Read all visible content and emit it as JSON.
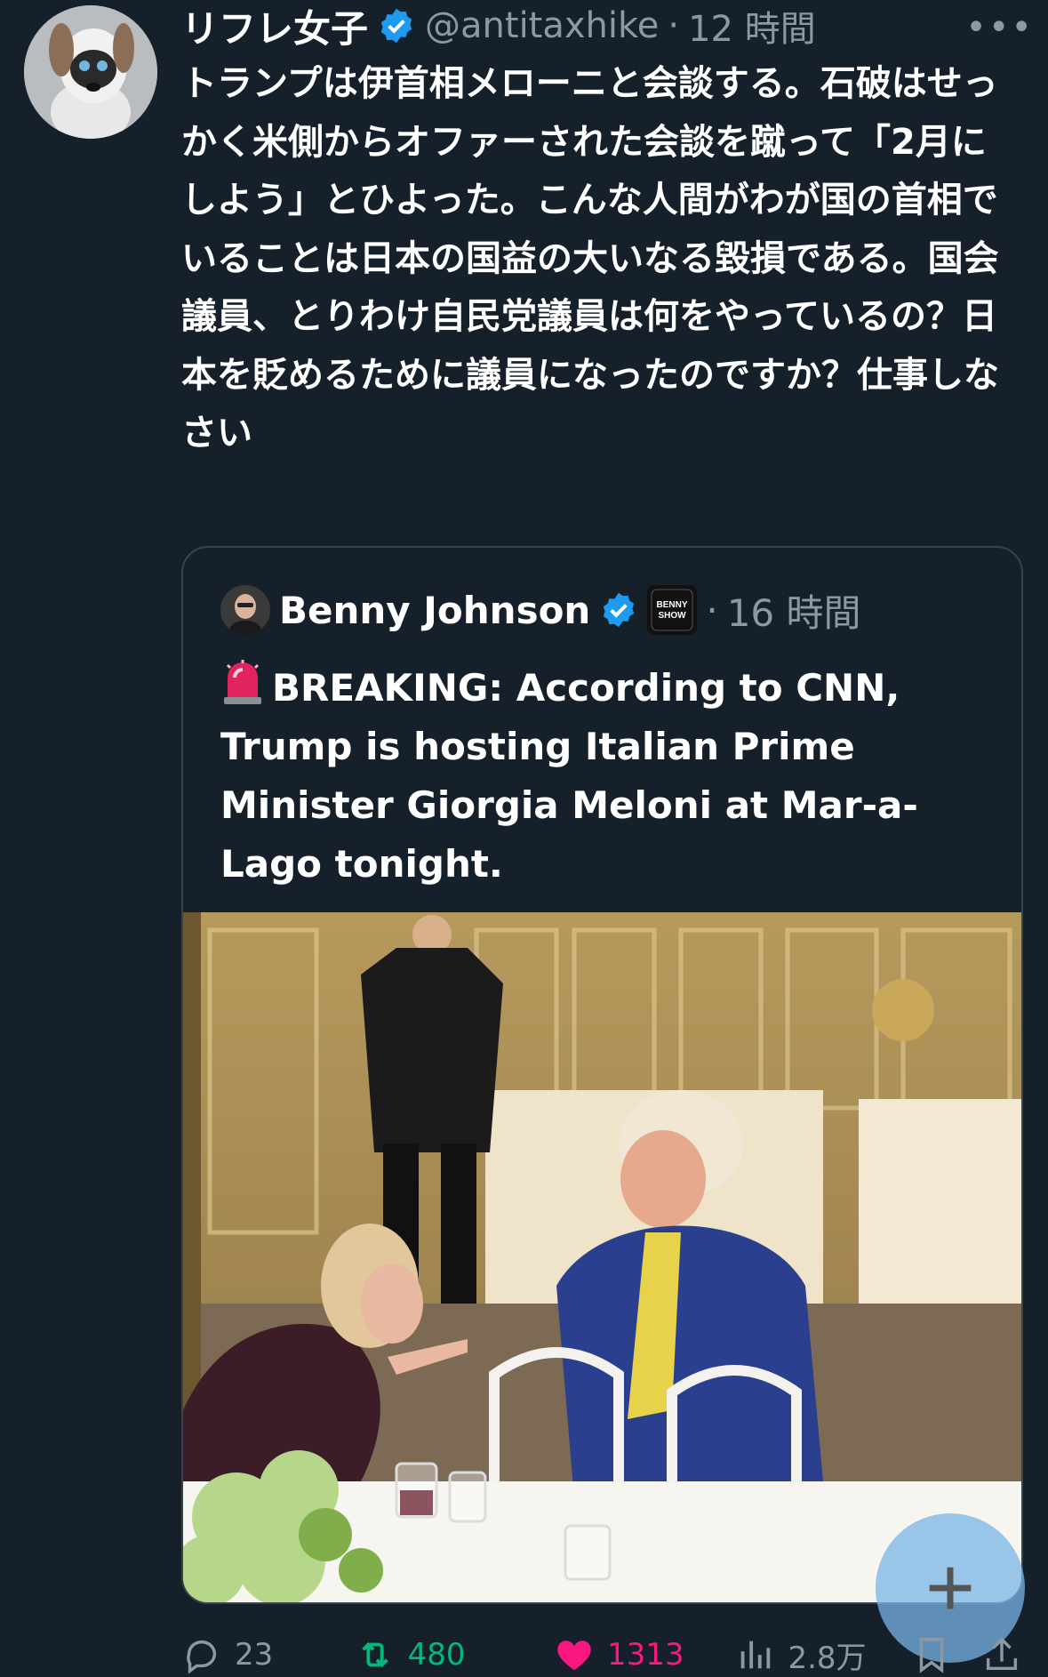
{
  "tweet": {
    "display_name": "リフレ女子",
    "handle": "@antitaxhike",
    "separator": "·",
    "time": "12 時間",
    "more_label": "•••",
    "body": "トランプは伊首相メローニと会談する。石破はせっかく米側からオファーされた会談を蹴って「2月にしよう」とひよった。こんな人間がわが国の首相でいることは日本の国益の大いなる毀損である。国会議員、とりわけ自民党議員は何をやっているの？日本を貶めるために議員になったのですか？仕事しなさい"
  },
  "quote": {
    "display_name": "Benny Johnson",
    "badge_text": "BENNY SHOW",
    "separator": "·",
    "time": "16 時間",
    "body": "BREAKING: According to CNN, Trump is hosting Italian Prime Minister Giorgia Meloni at Mar-a-Lago tonight."
  },
  "actions": {
    "replies": "23",
    "retweets": "480",
    "likes": "1313",
    "views": "2.8万"
  },
  "colors": {
    "background": "#15202b",
    "muted": "#8b98a5",
    "retweet": "#00ba7c",
    "like": "#f91880",
    "verified": "#1d9bf0"
  },
  "icons": [
    "verified-icon",
    "more-icon",
    "reply-icon",
    "retweet-icon",
    "heart-icon",
    "views-icon",
    "bookmark-icon",
    "share-icon",
    "siren-icon",
    "plus-icon"
  ]
}
